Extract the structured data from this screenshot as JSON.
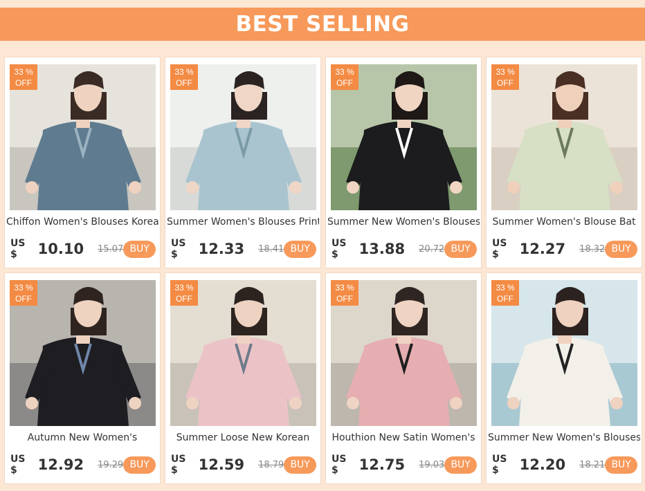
{
  "banner": {
    "title": "BEST SELLING"
  },
  "colors": {
    "banner": "#f7995a",
    "badge": "#f38b44",
    "buy": "#f7995a",
    "background": "#fce6d4"
  },
  "products": [
    {
      "title": "Chiffon Women's Blouses Korean",
      "currency": "US $",
      "price": "10.10",
      "old_price": "15.07",
      "discount_pct": "33 %",
      "discount_word": "OFF",
      "buy_label": "BUY",
      "palette": {
        "bg": "#c9c6c0",
        "wall": "#e6e3dc",
        "skin": "#efd2bf",
        "hair": "#3a2c25",
        "top": "#5f7b8f",
        "bottom": "#e9e4de",
        "accent": "#9bb3c1"
      }
    },
    {
      "title": "Summer Women's Blouses Print",
      "currency": "US $",
      "price": "12.33",
      "old_price": "18.41",
      "discount_pct": "33 %",
      "discount_word": "OFF",
      "buy_label": "BUY",
      "palette": {
        "bg": "#d8dad8",
        "wall": "#eef0ee",
        "skin": "#efd6c6",
        "hair": "#2b2321",
        "top": "#a9c4cf",
        "bottom": "#f7f7f5",
        "accent": "#7a9aa7"
      }
    },
    {
      "title": "Summer New Women's Blouses",
      "currency": "US $",
      "price": "13.88",
      "old_price": "20.72",
      "discount_pct": "33 %",
      "discount_word": "OFF",
      "buy_label": "BUY",
      "palette": {
        "bg": "#7e9a6e",
        "wall": "#b7c6a8",
        "skin": "#f0d5c3",
        "hair": "#1e1816",
        "top": "#1c1c1e",
        "bottom": "#f2f2f0",
        "accent": "#ffffff"
      }
    },
    {
      "title": "Summer Women's Blouse Bat",
      "currency": "US $",
      "price": "12.27",
      "old_price": "18.32",
      "discount_pct": "33 %",
      "discount_word": "OFF",
      "buy_label": "BUY",
      "palette": {
        "bg": "#d9cfc2",
        "wall": "#ece3d8",
        "skin": "#efd0bb",
        "hair": "#4a3024",
        "top": "#d7dfc4",
        "bottom": "#bfc9a8",
        "accent": "#6a7a5a"
      }
    },
    {
      "title": "Autumn New Women's",
      "currency": "US $",
      "price": "12.92",
      "old_price": "19.29",
      "discount_pct": "33 %",
      "discount_word": "OFF",
      "buy_label": "BUY",
      "palette": {
        "bg": "#8c8a88",
        "wall": "#b8b4ae",
        "skin": "#efd3c1",
        "hair": "#2f2420",
        "top": "#1d1d22",
        "bottom": "#4b5f7c",
        "accent": "#6f86a8"
      }
    },
    {
      "title": "Summer Loose New Korean",
      "currency": "US $",
      "price": "12.59",
      "old_price": "18.79",
      "discount_pct": "33 %",
      "discount_word": "OFF",
      "buy_label": "BUY",
      "palette": {
        "bg": "#c9c2b8",
        "wall": "#e4ddd2",
        "skin": "#efd3c2",
        "hair": "#2d2420",
        "top": "#ebc3c6",
        "bottom": "#f5f3ee",
        "accent": "#6e7b8c"
      }
    },
    {
      "title": "Houthion New Satin Women's",
      "currency": "US $",
      "price": "12.75",
      "old_price": "19.03",
      "discount_pct": "33 %",
      "discount_word": "OFF",
      "buy_label": "BUY",
      "palette": {
        "bg": "#bdb7ae",
        "wall": "#ddd6cb",
        "skin": "#efd3c3",
        "hair": "#2f2522",
        "top": "#e6aeb0",
        "bottom": "#f2f2f2",
        "accent": "#1f1f1f"
      }
    },
    {
      "title": "Summer New Women's Blouses",
      "currency": "US $",
      "price": "12.20",
      "old_price": "18.21",
      "discount_pct": "33 %",
      "discount_word": "OFF",
      "buy_label": "BUY",
      "palette": {
        "bg": "#a9c9d2",
        "wall": "#d6e6ea",
        "skin": "#efd2c0",
        "hair": "#2c221f",
        "top": "#f3f0ea",
        "bottom": "#1c1c1c",
        "accent": "#222222"
      }
    }
  ]
}
